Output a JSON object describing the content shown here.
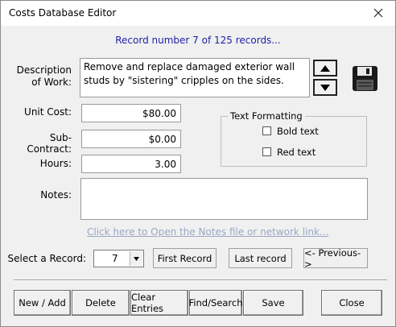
{
  "window": {
    "title": "Costs Database Editor"
  },
  "record_info": "Record number 7 of 125 records...",
  "labels": {
    "description": "Description of Work:",
    "unit_cost": "Unit Cost:",
    "sub_contract": "Sub-Contract:",
    "hours": "Hours:",
    "notes": "Notes:",
    "select_record": "Select a Record:"
  },
  "fields": {
    "description": "Remove and replace damaged exterior wall studs by \"sistering\" cripples on the sides.",
    "unit_cost": "$80.00",
    "sub_contract": "$0.00",
    "hours": "3.00",
    "notes": ""
  },
  "text_formatting": {
    "title": "Text Formatting",
    "bold_label": "Bold text",
    "bold_checked": false,
    "red_label": "Red text",
    "red_checked": false
  },
  "notes_link": "Click here to Open the Notes file or network link...",
  "record_select": {
    "value": "7"
  },
  "nav_buttons": {
    "first": "First Record",
    "last": "Last record",
    "previous": "<- Previous->"
  },
  "bottom_buttons": {
    "new_add": "New / Add",
    "delete": "Delete",
    "clear": "Clear Entries",
    "find": "Find/Search",
    "save": "Save",
    "close": "Close"
  },
  "icons": {
    "close": "close-icon",
    "up": "arrow-up-icon",
    "down": "arrow-down-icon",
    "save": "floppy-disk-icon",
    "dropdown": "chevron-down-icon"
  }
}
